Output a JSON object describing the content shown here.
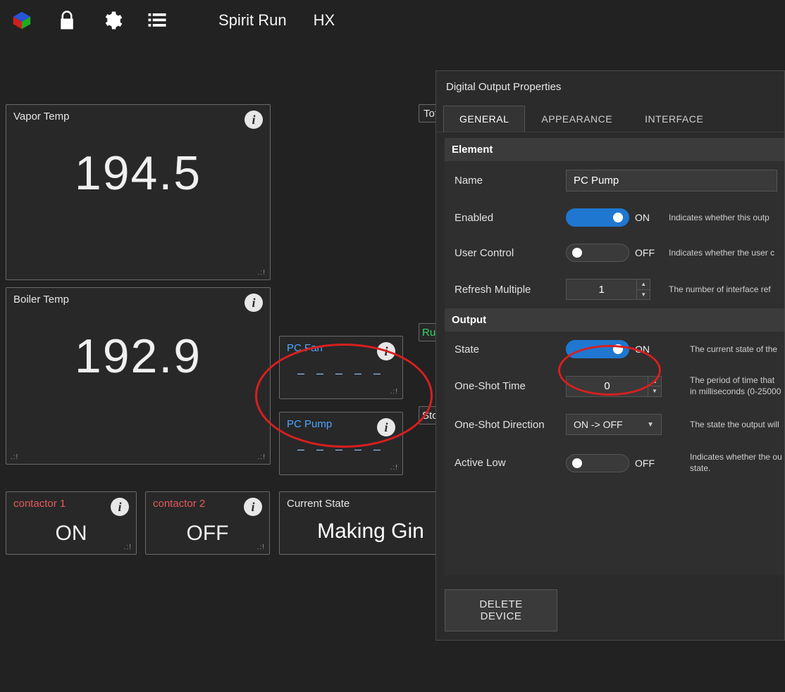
{
  "toolbar": {
    "nav1": "Spirit  Run",
    "nav2": "HX"
  },
  "panels": {
    "vapor": {
      "title": "Vapor Temp",
      "value": "194.5"
    },
    "boiler": {
      "title": "Boiler Temp",
      "value": "192.9"
    },
    "pcFan": {
      "title": "PC Fan",
      "value": "– – – – –"
    },
    "pcPump": {
      "title": "PC Pump",
      "value": "– – – – –"
    },
    "contactor1": {
      "title": "contactor 1",
      "value": "ON"
    },
    "contactor2": {
      "title": "contactor 2",
      "value": "OFF"
    },
    "currentState": {
      "title": "Current State",
      "value": "Making Gin"
    },
    "tot": {
      "title": "Tot"
    },
    "run": {
      "title": "Run"
    },
    "sto": {
      "title": "Sto"
    }
  },
  "dialog": {
    "title": "Digital Output Properties",
    "tabs": {
      "general": "GENERAL",
      "appearance": "APPEARANCE",
      "interface": "INTERFACE"
    },
    "section_element": "Element",
    "section_output": "Output",
    "fields": {
      "name": {
        "label": "Name",
        "value": "PC Pump"
      },
      "enabled": {
        "label": "Enabled",
        "value": "ON",
        "desc": "Indicates whether this outp"
      },
      "userControl": {
        "label": "User Control",
        "value": "OFF",
        "desc": "Indicates whether the user c"
      },
      "refreshMult": {
        "label": "Refresh Multiple",
        "value": "1",
        "desc": "The number of interface ref"
      },
      "state": {
        "label": "State",
        "value": "ON",
        "desc": "The current state of the"
      },
      "oneShotTime": {
        "label": "One-Shot Time",
        "value": "0",
        "desc": "The period of time that",
        "desc2": "in milliseconds (0-25000"
      },
      "oneShotDir": {
        "label": "One-Shot Direction",
        "value": "ON -> OFF",
        "desc": "The state the output will"
      },
      "activeLow": {
        "label": "Active Low",
        "value": "OFF",
        "desc": "Indicates whether the ou",
        "desc2": "state."
      }
    },
    "delete": "DELETE DEVICE"
  }
}
